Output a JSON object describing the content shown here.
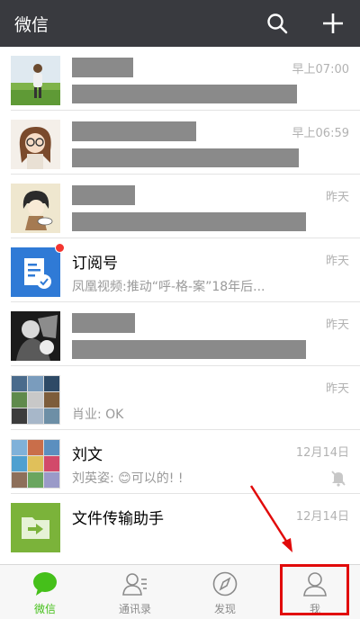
{
  "header": {
    "title": "微信",
    "search_icon": "search-icon",
    "add_icon": "plus-icon",
    "background": "#393a3f"
  },
  "chats": [
    {
      "name": "",
      "preview": "",
      "time": "早上07:00",
      "name_redacted": true,
      "preview_redacted": true,
      "avatar": "person-on-grass-photo"
    },
    {
      "name": "",
      "preview": "",
      "time": "早上06:59",
      "name_redacted": true,
      "preview_redacted": true,
      "avatar": "cartoon-girl-with-glasses"
    },
    {
      "name": "",
      "preview": "",
      "time": "昨天",
      "name_redacted": true,
      "preview_redacted": true,
      "avatar": "cartoon-girl-sketch"
    },
    {
      "name": "订阅号",
      "preview": "凤凰视频:推动“呼-格-案”18年后...",
      "time": "昨天",
      "unread_dot": true,
      "avatar": "subscription-icon"
    },
    {
      "name": "",
      "preview": "",
      "time": "昨天",
      "name_redacted": true,
      "preview_redacted": true,
      "avatar": "black-white-photo"
    },
    {
      "name": "",
      "preview": "肖业: OK",
      "time": "昨天",
      "avatar": "group-collage"
    },
    {
      "name": "刘文",
      "preview": "刘英姿: 😊可以的! !",
      "time": "12月14日",
      "muted": true,
      "avatar": "group-collage"
    },
    {
      "name": "文件传输助手",
      "preview": "",
      "time": "12月14日",
      "avatar": "file-transfer-icon"
    }
  ],
  "tabs": [
    {
      "label": "微信",
      "icon": "chat-bubble-icon",
      "active": true
    },
    {
      "label": "通讯录",
      "icon": "contacts-icon",
      "active": false
    },
    {
      "label": "发现",
      "icon": "compass-icon",
      "active": false
    },
    {
      "label": "我",
      "icon": "person-icon",
      "active": false
    }
  ],
  "colors": {
    "accent_green": "#45c01a",
    "unread_red": "#f43530",
    "annotation_red": "#e10a0a"
  }
}
